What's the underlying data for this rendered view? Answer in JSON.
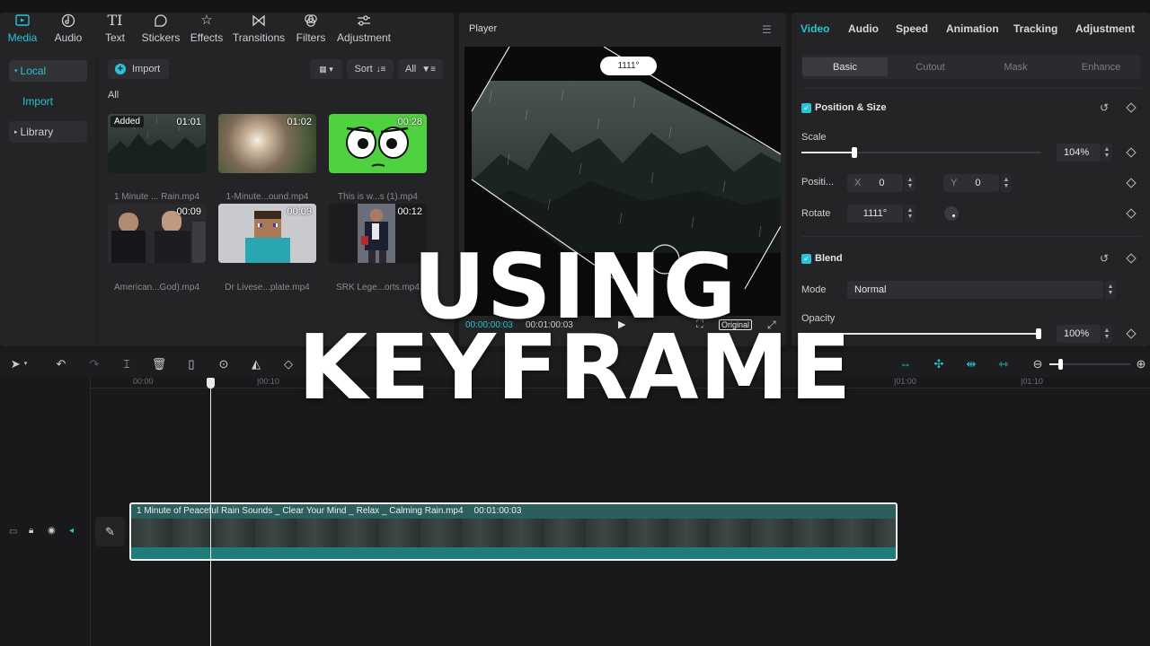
{
  "media_tabs": [
    {
      "label": "Media",
      "icon": "media-icon"
    },
    {
      "label": "Audio",
      "icon": "audio-icon"
    },
    {
      "label": "Text",
      "icon": "text-icon"
    },
    {
      "label": "Stickers",
      "icon": "stickers-icon"
    },
    {
      "label": "Effects",
      "icon": "effects-icon"
    },
    {
      "label": "Transitions",
      "icon": "transitions-icon"
    },
    {
      "label": "Filters",
      "icon": "filters-icon"
    },
    {
      "label": "Adjustment",
      "icon": "adjustment-icon"
    }
  ],
  "sidebar": {
    "local": "Local",
    "import": "Import",
    "library": "Library"
  },
  "media": {
    "import_label": "Import",
    "sort_label": "Sort",
    "filter_label": "All",
    "section_label": "All",
    "items": [
      {
        "name": "1 Minute ... Rain.mp4",
        "duration": "01:01",
        "badge": "Added"
      },
      {
        "name": "1-Minute...ound.mp4",
        "duration": "01:02"
      },
      {
        "name": "This is w...s (1).mp4",
        "duration": "00:28"
      },
      {
        "name": "American...God).mp4",
        "duration": "00:09"
      },
      {
        "name": "Dr Livese...plate.mp4",
        "duration": "00:09"
      },
      {
        "name": "SRK Lege...orts.mp4",
        "duration": "00:12"
      }
    ]
  },
  "player": {
    "title": "Player",
    "rotation_badge": "1111°",
    "current_time": "00:00:00:03",
    "total_time": "00:01:00:03",
    "ratio_label": "Original"
  },
  "inspector": {
    "tabs": [
      "Video",
      "Audio",
      "Speed",
      "Animation",
      "Tracking",
      "Adjustment"
    ],
    "subtabs": [
      "Basic",
      "Cutout",
      "Mask",
      "Enhance"
    ],
    "position_size": {
      "title": "Position & Size",
      "scale_label": "Scale",
      "scale_value": "104%",
      "scale_fraction": 0.22,
      "position_label": "Positi...",
      "x_label": "X",
      "x_value": "0",
      "y_label": "Y",
      "y_value": "0",
      "rotate_label": "Rotate",
      "rotate_value": "1111°"
    },
    "blend": {
      "title": "Blend",
      "mode_label": "Mode",
      "mode_value": "Normal",
      "opacity_label": "Opacity",
      "opacity_value": "100%",
      "opacity_fraction": 1.0
    }
  },
  "timeline": {
    "ticks": [
      "00:00",
      "|00:10",
      "|01:00",
      "|01:10"
    ],
    "clip_name": "1 Minute of Peaceful Rain Sounds _ Clear Your Mind _ Relax _ Calming Rain.mp4",
    "clip_duration": "00:01:00:03"
  },
  "overlay": {
    "line1": "USING",
    "line2": "KEYFRAME"
  },
  "colors": {
    "accent": "#28c3d4",
    "panel": "#242427",
    "background": "#19191b",
    "clip": "#2b5e5c"
  }
}
